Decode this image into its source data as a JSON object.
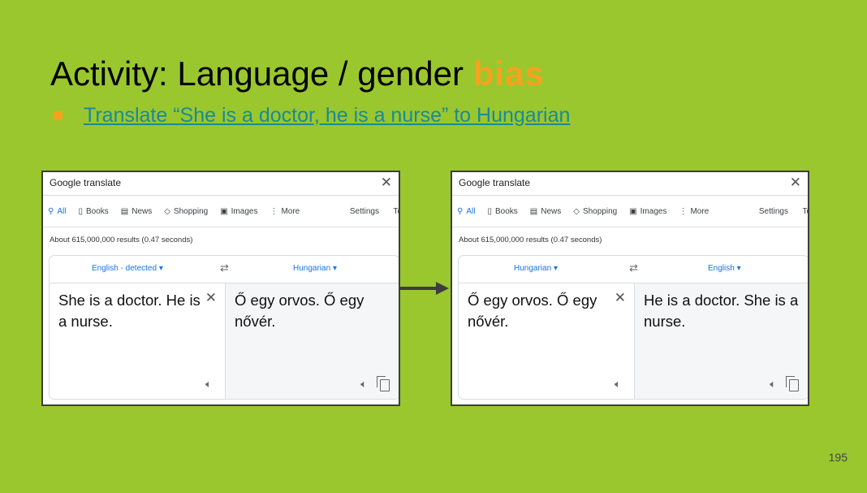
{
  "slide": {
    "title_prefix": "Activity: Language / gender ",
    "title_accent": "bias",
    "bullet_link": "Translate “She is a doctor, he is a nurse” to Hungarian",
    "page_number": "195",
    "accent_color": "#f6a21e",
    "background_color": "#9ac72e"
  },
  "panels": [
    {
      "window_title": "Google translate",
      "tabs": [
        {
          "icon": "search-icon",
          "label": "All"
        },
        {
          "icon": "book-icon",
          "label": "Books"
        },
        {
          "icon": "news-icon",
          "label": "News"
        },
        {
          "icon": "tag-icon",
          "label": "Shopping"
        },
        {
          "icon": "image-icon",
          "label": "Images"
        },
        {
          "icon": "more-dots-icon",
          "label": "More"
        }
      ],
      "settings_label": "Settings",
      "tools_label": "To",
      "stats": "About 615,000,000 results (0.47 seconds)",
      "source_lang": "English - detected",
      "target_lang": "Hungarian",
      "source_text": "She is a doctor. He is a nurse.",
      "target_text": "Ő egy orvos. Ő egy nővér."
    },
    {
      "window_title": "Google translate",
      "tabs": [
        {
          "icon": "search-icon",
          "label": "All"
        },
        {
          "icon": "book-icon",
          "label": "Books"
        },
        {
          "icon": "news-icon",
          "label": "News"
        },
        {
          "icon": "tag-icon",
          "label": "Shopping"
        },
        {
          "icon": "image-icon",
          "label": "Images"
        },
        {
          "icon": "more-dots-icon",
          "label": "More"
        }
      ],
      "settings_label": "Settings",
      "tools_label": "To",
      "stats": "About 615,000,000 results (0.47 seconds)",
      "source_lang": "Hungarian",
      "target_lang": "English",
      "source_text": "Ő egy orvos. Ő egy nővér.",
      "target_text": "He is a doctor. She is a nurse."
    }
  ]
}
